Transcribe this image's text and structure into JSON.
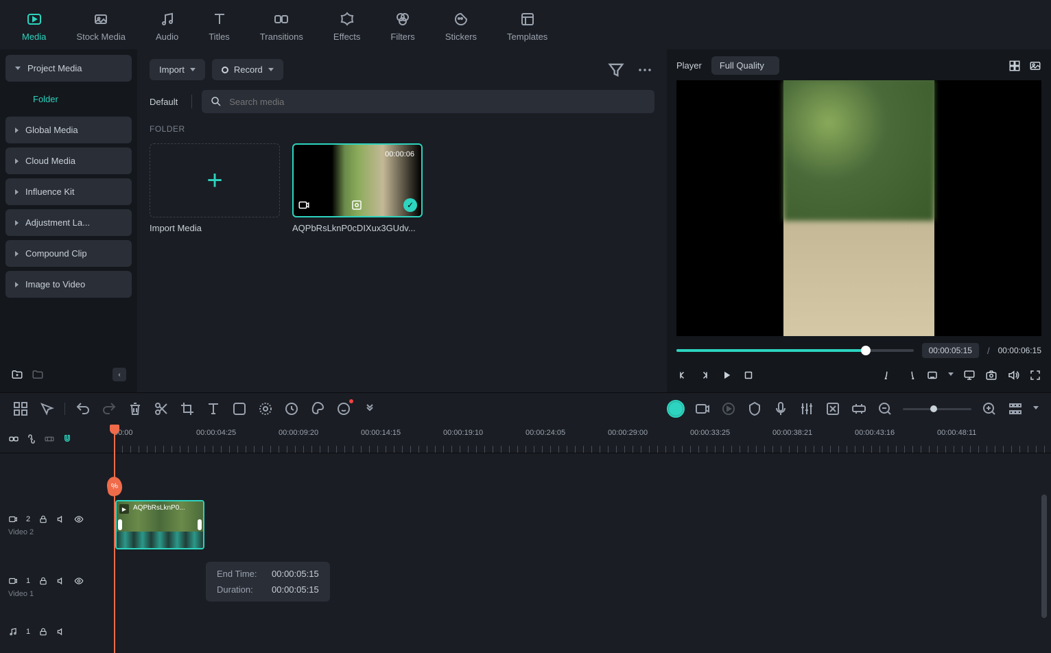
{
  "top_tabs": {
    "media": "Media",
    "stock_media": "Stock Media",
    "audio": "Audio",
    "titles": "Titles",
    "transitions": "Transitions",
    "effects": "Effects",
    "filters": "Filters",
    "stickers": "Stickers",
    "templates": "Templates"
  },
  "sidebar": {
    "project_media": "Project Media",
    "folder": "Folder",
    "global_media": "Global Media",
    "cloud_media": "Cloud Media",
    "influence_kit": "Influence Kit",
    "adjustment_layer": "Adjustment La...",
    "compound_clip": "Compound Clip",
    "image_to_video": "Image to Video"
  },
  "media_panel": {
    "import_btn": "Import",
    "record_btn": "Record",
    "sort": "Default",
    "search_placeholder": "Search media",
    "folder_header": "FOLDER",
    "import_card": "Import Media",
    "clip_duration": "00:00:06",
    "clip_name": "AQPbRsLknP0cDIXux3GUdv..."
  },
  "player": {
    "title": "Player",
    "quality": "Full Quality",
    "current_time": "00:00:05:15",
    "total_time": "00:00:06:15"
  },
  "ruler": {
    "labels": [
      "00:00",
      "00:00:04:25",
      "00:00:09:20",
      "00:00:14:15",
      "00:00:19:10",
      "00:00:24:05",
      "00:00:29:00",
      "00:00:33:25",
      "00:00:38:21",
      "00:00:43:16",
      "00:00:48:11"
    ]
  },
  "tracks": {
    "video2": {
      "num": "2",
      "name": "Video 2"
    },
    "video1": {
      "num": "1",
      "name": "Video 1"
    },
    "audio1": {
      "num": "1"
    }
  },
  "clip_on_track": "AQPbRsLknP0...",
  "tooltip": {
    "end_time_label": "End Time:",
    "end_time_value": "00:00:05:15",
    "duration_label": "Duration:",
    "duration_value": "00:00:05:15"
  }
}
